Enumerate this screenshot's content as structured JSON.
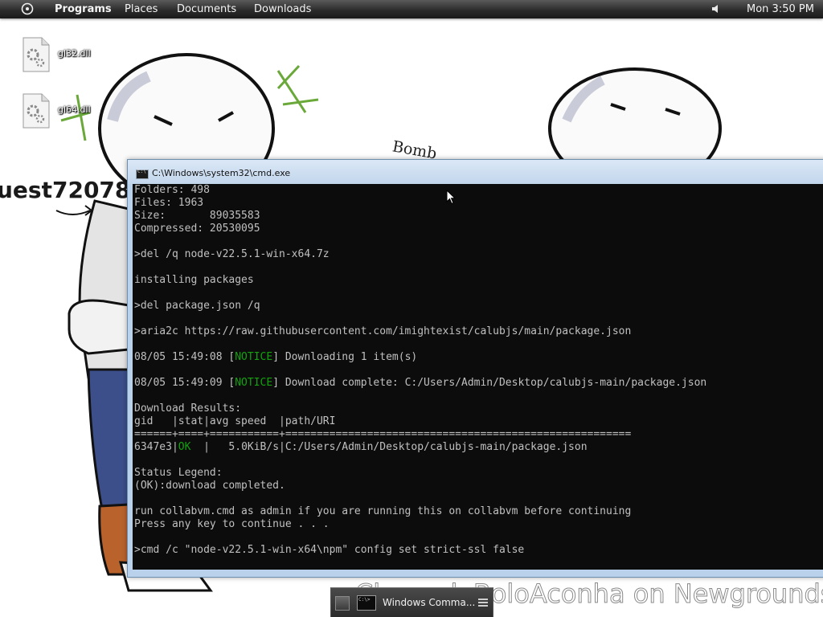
{
  "top_panel": {
    "launcher_icon": "circle-launcher-icon",
    "menus": {
      "programs": "Programs",
      "places": "Places",
      "documents": "Documents",
      "downloads": "Downloads"
    },
    "volume_icon": "speaker-icon",
    "clock": "Mon 3:50 PM"
  },
  "desktop_icons": [
    {
      "label": "gl32.dll",
      "icon": "dll-file-icon"
    },
    {
      "label": "gl64.dll",
      "icon": "dll-file-icon"
    }
  ],
  "wallpaper": {
    "user_text": "uest72078",
    "bomb_text": "Bomb",
    "watermark": "CherrydoBoloAconha on Newgrounds."
  },
  "cmd_window": {
    "title": "C:\\Windows\\system32\\cmd.exe",
    "title_icon": "console-icon",
    "lines": [
      [
        "Folders: 498"
      ],
      [
        "Files: 1963"
      ],
      [
        "Size:       89035583"
      ],
      [
        "Compressed: 20530095"
      ],
      [
        ""
      ],
      [
        ">del /q node-v22.5.1-win-x64.7z"
      ],
      [
        ""
      ],
      [
        "installing packages"
      ],
      [
        ""
      ],
      [
        ">del package.json /q"
      ],
      [
        ""
      ],
      [
        ">aria2c https://raw.githubusercontent.com/imightexist/calubjs/main/package.json"
      ],
      [
        ""
      ],
      [
        "08/05 15:49:08 [",
        "NOTICE",
        "] Downloading 1 item(s)"
      ],
      [
        ""
      ],
      [
        "08/05 15:49:09 [",
        "NOTICE",
        "] Download complete: C:/Users/Admin/Desktop/calubjs-main/package.json"
      ],
      [
        ""
      ],
      [
        "Download Results:"
      ],
      [
        "gid   |stat|avg speed  |path/URI"
      ],
      [
        "======+====+===========+======================================================="
      ],
      [
        "6347e3|",
        "OK",
        "  |   5.0KiB/s|C:/Users/Admin/Desktop/calubjs-main/package.json"
      ],
      [
        ""
      ],
      [
        "Status Legend:"
      ],
      [
        "(OK):download completed."
      ],
      [
        ""
      ],
      [
        "run collabvm.cmd as admin if you are running this on collabvm before continuing"
      ],
      [
        "Press any key to continue . . ."
      ],
      [
        ""
      ],
      [
        ">cmd /c \"node-v22.5.1-win-x64\\npm\" config set strict-ssl false"
      ]
    ],
    "colors": {
      "background": "#0c0c0c",
      "text": "#c0c0c0",
      "highlight": "#13a10e"
    }
  },
  "taskbar": {
    "item_label": "Windows Comma...",
    "item_icon": "console-icon",
    "menu_icon": "hamburger-menu-icon"
  }
}
